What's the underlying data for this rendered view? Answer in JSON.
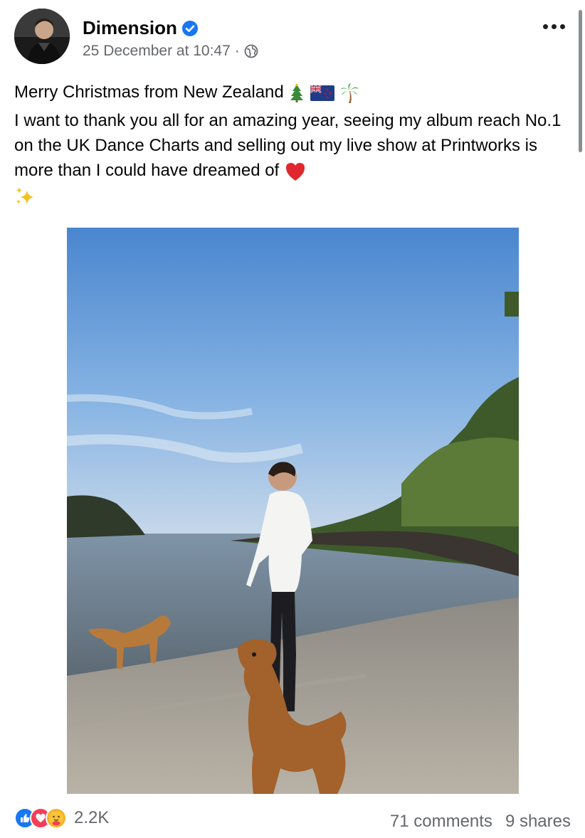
{
  "post": {
    "author": "Dimension",
    "timestamp": "25 December at 10:47",
    "separator": "·",
    "privacy_icon": "globe-icon",
    "line1": "Merry Christmas from New Zealand",
    "line1_emojis": [
      "christmas-tree",
      "nz-flag",
      "palm-tree"
    ],
    "body": "I want to thank you all for an amazing year, seeing my album reach No.1 on the UK Dance Charts and selling out my live show at Printworks is more than I could have dreamed of",
    "body_emojis": [
      "red-heart",
      "sparkles"
    ]
  },
  "footer": {
    "reactions": [
      "like",
      "love",
      "care"
    ],
    "reaction_count": "2.2K",
    "comments": "71 comments",
    "shares": "9 shares"
  },
  "colors": {
    "verified": "#1877f2",
    "like": "#1877f2",
    "love": "#f33e58",
    "care": "#f7b125",
    "secondary_text": "#65676b"
  }
}
